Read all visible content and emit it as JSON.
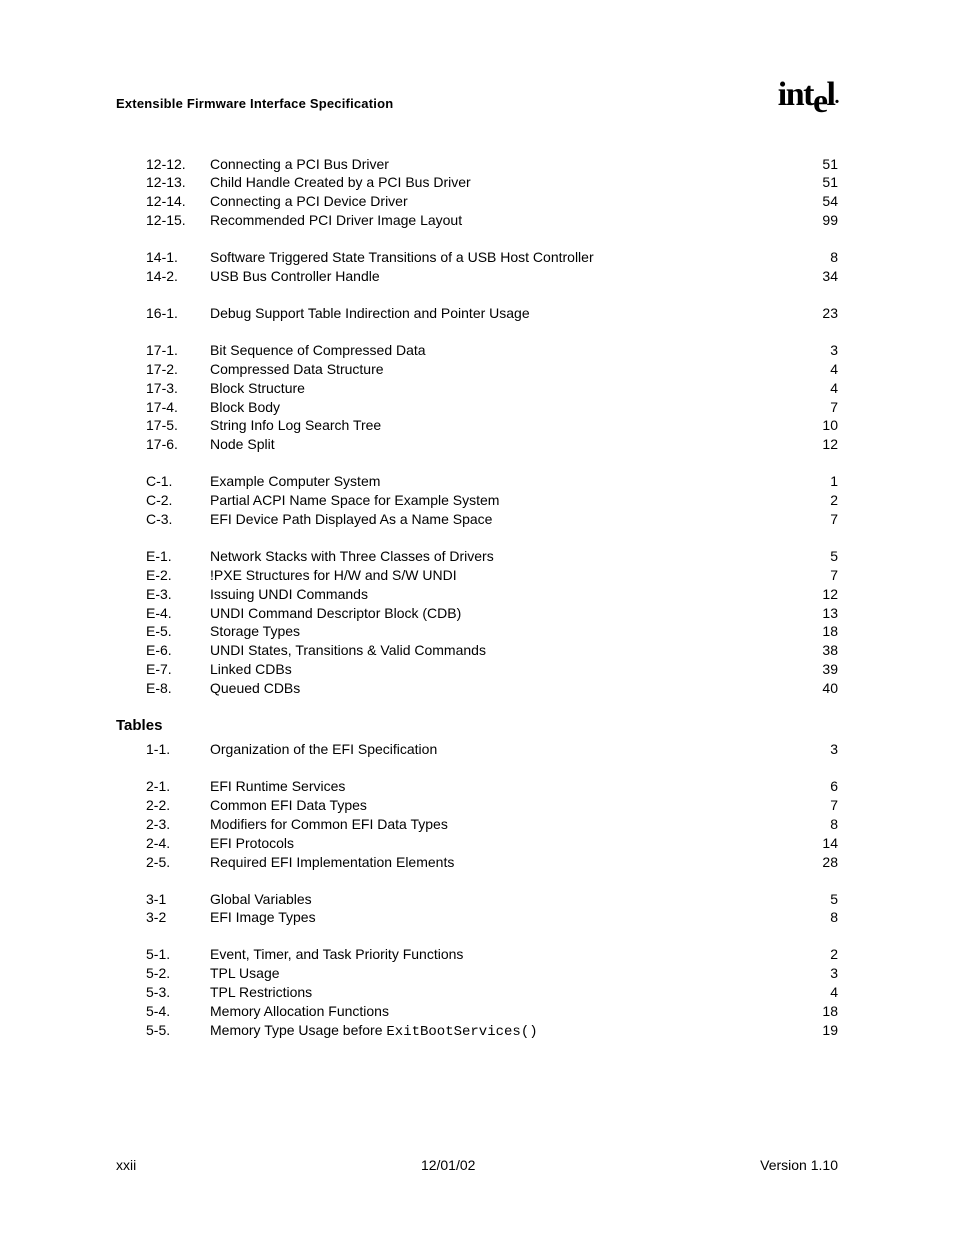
{
  "header": {
    "title": "Extensible Firmware Interface Specification",
    "logo_text_1": "int",
    "logo_text_2": "e",
    "logo_text_3": "l",
    "logo_dot": "."
  },
  "sections": [
    {
      "entries": [
        {
          "num": "12-12.",
          "title": "Connecting a PCI Bus Driver",
          "page": "51"
        },
        {
          "num": "12-13.",
          "title": "Child Handle Created by a PCI Bus Driver",
          "page": "51"
        },
        {
          "num": "12-14.",
          "title": "Connecting a PCI Device Driver",
          "page": "54"
        },
        {
          "num": "12-15.",
          "title": "Recommended PCI Driver Image Layout",
          "page": "99"
        }
      ]
    },
    {
      "entries": [
        {
          "num": "14-1.",
          "title": "Software Triggered State Transitions of a USB Host Controller",
          "page": "8"
        },
        {
          "num": "14-2.",
          "title": "USB Bus Controller Handle",
          "page": "34"
        }
      ]
    },
    {
      "entries": [
        {
          "num": "16-1.",
          "title": "Debug Support Table Indirection and Pointer Usage",
          "page": "23"
        }
      ]
    },
    {
      "entries": [
        {
          "num": "17-1.",
          "title": "Bit Sequence of Compressed Data",
          "page": "3"
        },
        {
          "num": "17-2.",
          "title": "Compressed Data Structure",
          "page": "4"
        },
        {
          "num": "17-3.",
          "title": "Block Structure",
          "page": "4"
        },
        {
          "num": "17-4.",
          "title": "Block Body",
          "page": "7"
        },
        {
          "num": "17-5.",
          "title": "String Info Log Search Tree",
          "page": "10"
        },
        {
          "num": "17-6.",
          "title": "Node Split",
          "page": "12"
        }
      ]
    },
    {
      "entries": [
        {
          "num": "C-1.",
          "title": "Example Computer System",
          "page": "1"
        },
        {
          "num": "C-2.",
          "title": "Partial ACPI Name Space for Example System",
          "page": "2"
        },
        {
          "num": "C-3.",
          "title": "EFI Device Path Displayed As a Name Space",
          "page": "7"
        }
      ]
    },
    {
      "entries": [
        {
          "num": "E-1.",
          "title": "Network Stacks with Three Classes of Drivers",
          "page": "5"
        },
        {
          "num": "E-2.",
          "title": "!PXE Structures for H/W and S/W UNDI",
          "page": "7"
        },
        {
          "num": "E-3.",
          "title": "Issuing UNDI Commands",
          "page": "12"
        },
        {
          "num": "E-4.",
          "title": "UNDI Command Descriptor Block (CDB)",
          "page": "13"
        },
        {
          "num": "E-5.",
          "title": "Storage Types",
          "page": "18"
        },
        {
          "num": "E-6.",
          "title": "UNDI States, Transitions & Valid Commands",
          "page": "38"
        },
        {
          "num": "E-7.",
          "title": "Linked CDBs",
          "page": "39"
        },
        {
          "num": "E-8.",
          "title": "Queued CDBs",
          "page": "40"
        }
      ]
    }
  ],
  "tables_heading": "Tables",
  "tables": [
    {
      "entries": [
        {
          "num": "1-1.",
          "title": "Organization of the EFI Specification",
          "page": "3"
        }
      ]
    },
    {
      "entries": [
        {
          "num": "2-1.",
          "title": "EFI Runtime Services",
          "page": "6"
        },
        {
          "num": "2-2.",
          "title": "Common EFI Data Types",
          "page": "7"
        },
        {
          "num": "2-3.",
          "title": "Modifiers for Common EFI Data Types",
          "page": "8"
        },
        {
          "num": "2-4.",
          "title": "EFI Protocols",
          "page": "14"
        },
        {
          "num": "2-5.",
          "title": "Required EFI Implementation Elements",
          "page": "28"
        }
      ]
    },
    {
      "entries": [
        {
          "num": "3-1",
          "title": "Global Variables",
          "page": "5"
        },
        {
          "num": "3-2",
          "title": "EFI Image Types",
          "page": "8"
        }
      ]
    },
    {
      "entries": [
        {
          "num": "5-1.",
          "title": "Event, Timer, and Task Priority Functions",
          "page": "2"
        },
        {
          "num": "5-2.",
          "title": "TPL Usage",
          "page": "3"
        },
        {
          "num": "5-3.",
          "title": "TPL Restrictions",
          "page": "4"
        },
        {
          "num": "5-4.",
          "title": "Memory Allocation Functions",
          "page": "18"
        },
        {
          "num": "5-5.",
          "title_pre": "Memory Type Usage before ",
          "title_mono": "ExitBootServices()",
          "page": "19"
        }
      ]
    }
  ],
  "footer": {
    "left": "xxii",
    "center": "12/01/02",
    "right": "Version 1.10"
  }
}
